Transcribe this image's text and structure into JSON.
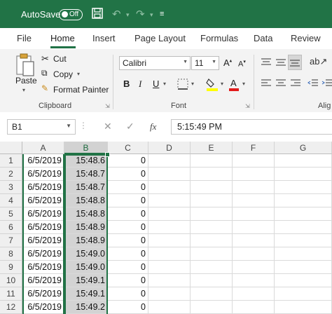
{
  "titlebar": {
    "autosave_label": "AutoSave",
    "toggle_state": "Off"
  },
  "tabs": [
    "File",
    "Home",
    "Insert",
    "Page Layout",
    "Formulas",
    "Data",
    "Review"
  ],
  "ribbon": {
    "clipboard": {
      "paste": "Paste",
      "cut": "Cut",
      "copy": "Copy",
      "format_painter": "Format Painter",
      "label": "Clipboard"
    },
    "font": {
      "name": "Calibri",
      "size": "11",
      "label": "Font",
      "bold": "B",
      "italic": "I",
      "underline": "U"
    },
    "alignment_label": "Alig"
  },
  "formula_bar": {
    "name_box": "B1",
    "fx": "fx",
    "value": "5:15:49 PM"
  },
  "sheet": {
    "columns": [
      "A",
      "B",
      "C",
      "D",
      "E",
      "F",
      "G"
    ],
    "selected_column": "B",
    "rows": [
      {
        "n": "1",
        "A": "6/5/2019",
        "B": "15:48.6",
        "C": "0"
      },
      {
        "n": "2",
        "A": "6/5/2019",
        "B": "15:48.7",
        "C": "0"
      },
      {
        "n": "3",
        "A": "6/5/2019",
        "B": "15:48.7",
        "C": "0"
      },
      {
        "n": "4",
        "A": "6/5/2019",
        "B": "15:48.8",
        "C": "0"
      },
      {
        "n": "5",
        "A": "6/5/2019",
        "B": "15:48.8",
        "C": "0"
      },
      {
        "n": "6",
        "A": "6/5/2019",
        "B": "15:48.9",
        "C": "0"
      },
      {
        "n": "7",
        "A": "6/5/2019",
        "B": "15:48.9",
        "C": "0"
      },
      {
        "n": "8",
        "A": "6/5/2019",
        "B": "15:49.0",
        "C": "0"
      },
      {
        "n": "9",
        "A": "6/5/2019",
        "B": "15:49.0",
        "C": "0"
      },
      {
        "n": "10",
        "A": "6/5/2019",
        "B": "15:49.1",
        "C": "0"
      },
      {
        "n": "11",
        "A": "6/5/2019",
        "B": "15:49.1",
        "C": "0"
      },
      {
        "n": "12",
        "A": "6/5/2019",
        "B": "15:49.2",
        "C": "0"
      }
    ]
  },
  "colors": {
    "accent": "#217346",
    "ribbon_bg": "#f3f3f3",
    "selection": "#d3d3d3"
  }
}
